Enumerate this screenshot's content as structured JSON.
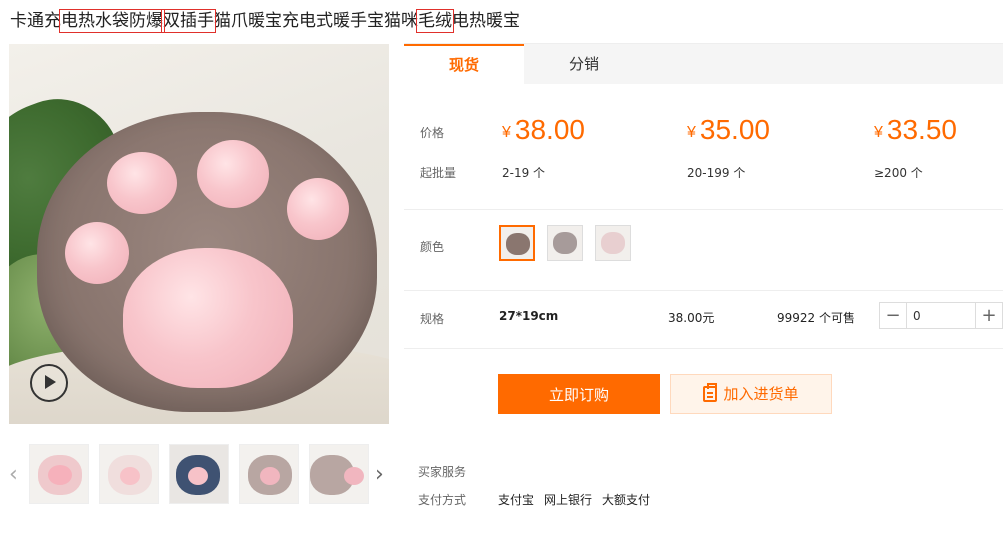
{
  "product": {
    "title_parts": [
      {
        "text": "卡通充",
        "hl": false
      },
      {
        "text": "电热水袋防爆",
        "hl": true
      },
      {
        "text": "双插手",
        "hl": true
      },
      {
        "text": "猫爪暖宝充电式暖手宝猫咪",
        "hl": false
      },
      {
        "text": "毛绒",
        "hl": true
      },
      {
        "text": "电热暖宝",
        "hl": false
      }
    ]
  },
  "tabs": [
    {
      "label": "现货",
      "active": true
    },
    {
      "label": "分销",
      "active": false
    }
  ],
  "pricing": {
    "price_label": "价格",
    "moq_label": "起批量",
    "currency": "¥",
    "tiers": [
      {
        "price": "38.00",
        "qty": "2-19 个"
      },
      {
        "price": "35.00",
        "qty": "20-199 个"
      },
      {
        "price": "33.50",
        "qty": "≥200 个"
      }
    ]
  },
  "colors": {
    "label": "颜色",
    "options": [
      {
        "name": "brown",
        "hex": "#8a766f",
        "selected": true
      },
      {
        "name": "gray",
        "hex": "#a79b9a",
        "selected": false
      },
      {
        "name": "pink",
        "hex": "#e8cfd0",
        "selected": false
      }
    ]
  },
  "spec": {
    "label": "规格",
    "size": "27*19cm",
    "price": "38.00元",
    "stock": "99922 个可售",
    "quantity": "0",
    "minus": "−",
    "plus": "+"
  },
  "actions": {
    "buy": "立即订购",
    "cart": "加入进货单"
  },
  "services": {
    "buyer_label": "买家服务",
    "payment_label": "支付方式",
    "payment_methods": [
      "支付宝",
      "网上银行",
      "大额支付"
    ]
  },
  "gallery": {
    "thumbnails": 5
  },
  "colors_theme": {
    "accent": "#ff6a00",
    "highlight_box": "#e0302b"
  }
}
